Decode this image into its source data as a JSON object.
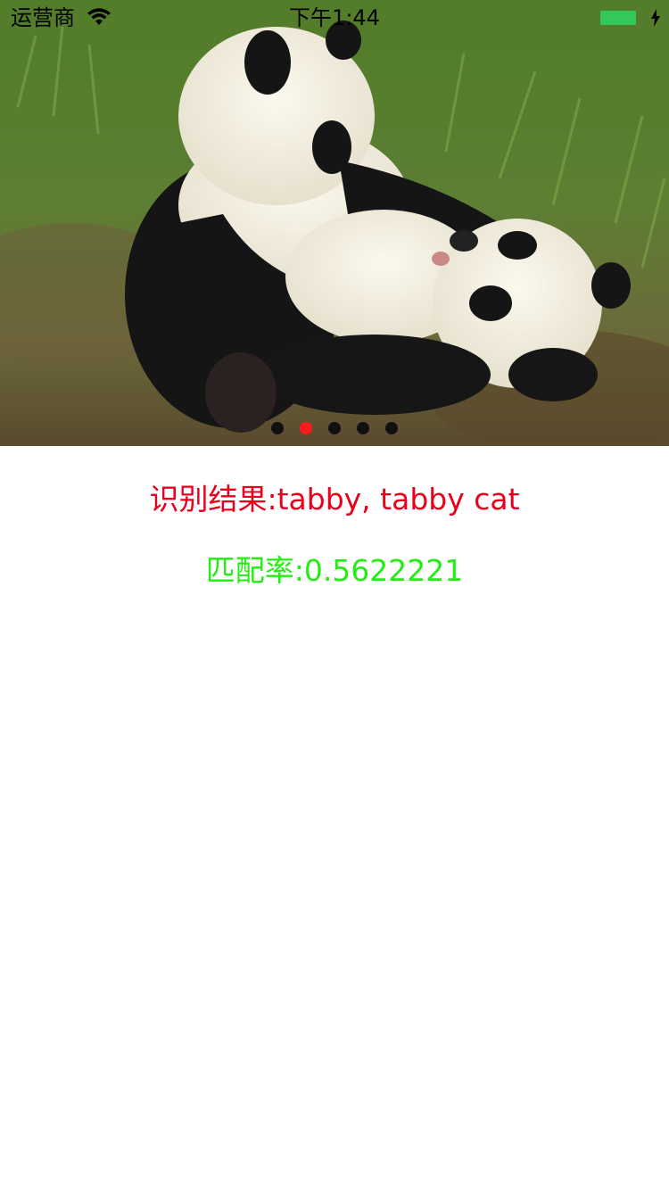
{
  "status_bar": {
    "carrier": "运营商",
    "time": "下午1:44",
    "battery_color": "#34c759"
  },
  "carousel": {
    "image": "panda-cubs-photo",
    "page_count": 5,
    "current_page": 2,
    "active_dot_color": "#ff1a1a",
    "inactive_dot_color": "#111111"
  },
  "result": {
    "label": "识别结果:tabby, tabby cat",
    "color": "#e8001c"
  },
  "match": {
    "label": "匹配率:0.5622221",
    "color": "#22ee11"
  }
}
